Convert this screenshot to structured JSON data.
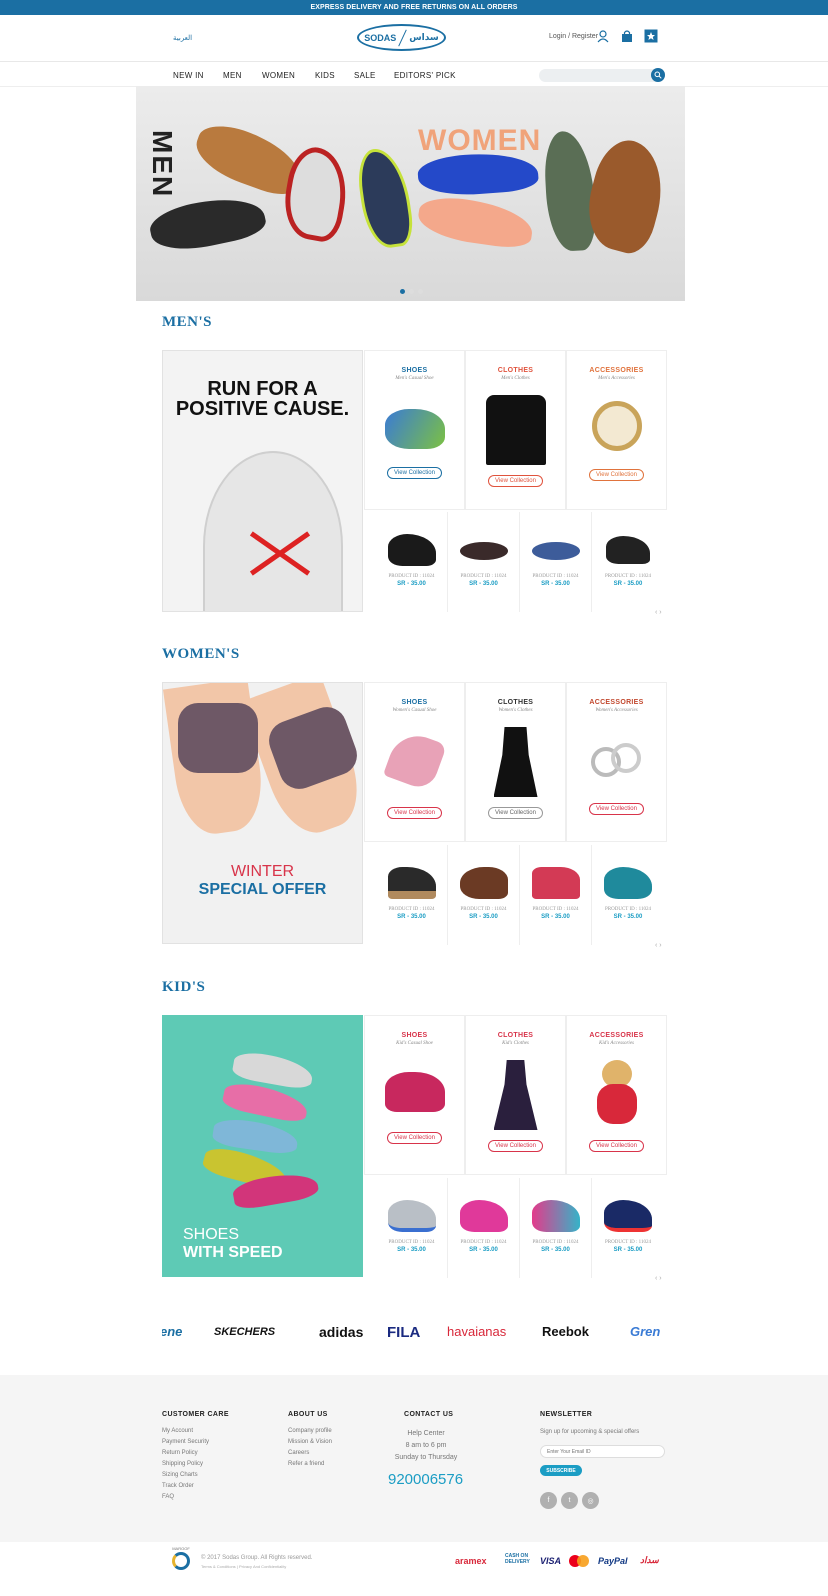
{
  "topbar": {
    "text": "EXPRESS DELIVERY AND FREE RETURNS ON ALL ORDERS"
  },
  "header": {
    "lang": "العربية",
    "logo_en": "SODAS",
    "logo_ar": "سداس",
    "login": "Login / Register"
  },
  "nav": {
    "items": [
      "NEW IN",
      "MEN",
      "WOMEN",
      "KIDS",
      "SALE",
      "EDITORS' PICK"
    ]
  },
  "hero": {
    "men": "MEN",
    "women": "WOMEN"
  },
  "sections": [
    {
      "title": "MEN'S",
      "promo": {
        "line1": "RUN FOR A",
        "line2": "POSITIVE CAUSE."
      },
      "cats": [
        {
          "title": "SHOES",
          "sub": "Men's Casual Shoe",
          "btn": "View Collection",
          "color": "#1b6fa3"
        },
        {
          "title": "CLOTHES",
          "sub": "Men's Clothes",
          "btn": "View Collection",
          "color": "#e0533d"
        },
        {
          "title": "ACCESSORIES",
          "sub": "Men's Accessories",
          "btn": "View Collection",
          "color": "#e0733d"
        }
      ]
    },
    {
      "title": "WOMEN'S",
      "promo": {
        "line1": "WINTER",
        "line2": "SPECIAL OFFER"
      },
      "cats": [
        {
          "title": "SHOES",
          "sub": "Women's Casual Shoe",
          "btn": "View Collection",
          "color": "#1b6fa3"
        },
        {
          "title": "CLOTHES",
          "sub": "Women's Clothes",
          "btn": "View Collection",
          "color": "#333333"
        },
        {
          "title": "ACCESSORIES",
          "sub": "Women's Accessories",
          "btn": "View Collection",
          "color": "#c2482e"
        }
      ]
    },
    {
      "title": "KID'S",
      "promo": {
        "line1": "SHOES",
        "line2": "WITH SPEED"
      },
      "cats": [
        {
          "title": "SHOES",
          "sub": "Kid's Casual Shoe",
          "btn": "View Collection",
          "color": "#d8344a"
        },
        {
          "title": "CLOTHES",
          "sub": "Kid's Clothes",
          "btn": "View Collection",
          "color": "#d8344a"
        },
        {
          "title": "ACCESSORIES",
          "sub": "Kid's Accessories",
          "btn": "View Collection",
          "color": "#d8344a"
        }
      ]
    }
  ],
  "product": {
    "id": "PRODUCT ID : 11024",
    "price": "SR - 35.00"
  },
  "brands": [
    "ene",
    "SKECHERS",
    "adidas",
    "FILA",
    "havaianas",
    "Reebok",
    "Gren"
  ],
  "footer": {
    "care_title": "CUSTOMER CARE",
    "care": [
      "My Account",
      "Payment Security",
      "Return Policy",
      "Shipping Policy",
      "Sizing Charts",
      "Track Order",
      "FAQ"
    ],
    "about_title": "ABOUT US",
    "about": [
      "Company profile",
      "Mission & Vision",
      "Careers",
      "Refer a friend"
    ],
    "contact_title": "CONTACT US",
    "contact": [
      "Help Center",
      "8 am to 6 pm",
      "Sunday to Thursday"
    ],
    "phone": "920006576",
    "news_title": "NEWSLETTER",
    "news_sub": "Sign up for upcoming & special offers",
    "email_placeholder": "Enter Your Email ID",
    "subscribe": "SUBSCRIBE"
  },
  "bottom": {
    "badge": "MAROOF",
    "copyright": "© 2017 Sodas Group. All Rights reserved.",
    "terms": "Terms & Conditions  |  Privacy And Confidentiality",
    "payments": [
      "aramex",
      "CASH ON DELIVERY",
      "VISA",
      "PayPal",
      "سداد"
    ]
  }
}
